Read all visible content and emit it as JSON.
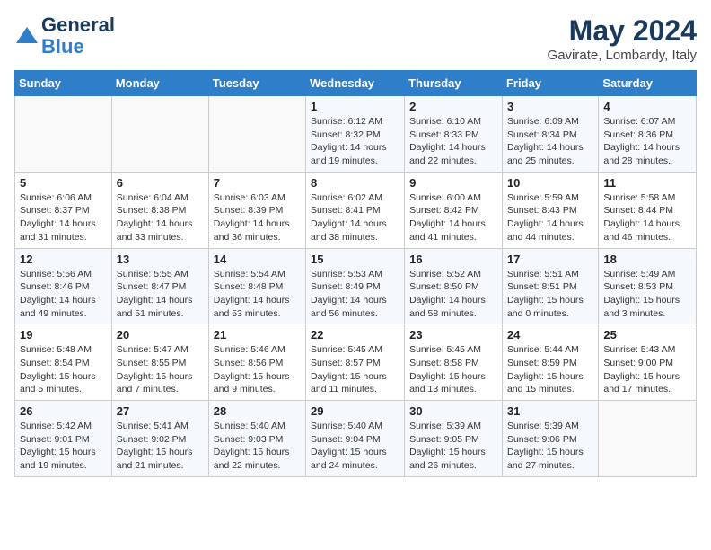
{
  "logo": {
    "line1": "General",
    "line2": "Blue"
  },
  "title": "May 2024",
  "location": "Gavirate, Lombardy, Italy",
  "weekdays": [
    "Sunday",
    "Monday",
    "Tuesday",
    "Wednesday",
    "Thursday",
    "Friday",
    "Saturday"
  ],
  "weeks": [
    [
      {
        "day": "",
        "info": ""
      },
      {
        "day": "",
        "info": ""
      },
      {
        "day": "",
        "info": ""
      },
      {
        "day": "1",
        "info": "Sunrise: 6:12 AM\nSunset: 8:32 PM\nDaylight: 14 hours\nand 19 minutes."
      },
      {
        "day": "2",
        "info": "Sunrise: 6:10 AM\nSunset: 8:33 PM\nDaylight: 14 hours\nand 22 minutes."
      },
      {
        "day": "3",
        "info": "Sunrise: 6:09 AM\nSunset: 8:34 PM\nDaylight: 14 hours\nand 25 minutes."
      },
      {
        "day": "4",
        "info": "Sunrise: 6:07 AM\nSunset: 8:36 PM\nDaylight: 14 hours\nand 28 minutes."
      }
    ],
    [
      {
        "day": "5",
        "info": "Sunrise: 6:06 AM\nSunset: 8:37 PM\nDaylight: 14 hours\nand 31 minutes."
      },
      {
        "day": "6",
        "info": "Sunrise: 6:04 AM\nSunset: 8:38 PM\nDaylight: 14 hours\nand 33 minutes."
      },
      {
        "day": "7",
        "info": "Sunrise: 6:03 AM\nSunset: 8:39 PM\nDaylight: 14 hours\nand 36 minutes."
      },
      {
        "day": "8",
        "info": "Sunrise: 6:02 AM\nSunset: 8:41 PM\nDaylight: 14 hours\nand 38 minutes."
      },
      {
        "day": "9",
        "info": "Sunrise: 6:00 AM\nSunset: 8:42 PM\nDaylight: 14 hours\nand 41 minutes."
      },
      {
        "day": "10",
        "info": "Sunrise: 5:59 AM\nSunset: 8:43 PM\nDaylight: 14 hours\nand 44 minutes."
      },
      {
        "day": "11",
        "info": "Sunrise: 5:58 AM\nSunset: 8:44 PM\nDaylight: 14 hours\nand 46 minutes."
      }
    ],
    [
      {
        "day": "12",
        "info": "Sunrise: 5:56 AM\nSunset: 8:46 PM\nDaylight: 14 hours\nand 49 minutes."
      },
      {
        "day": "13",
        "info": "Sunrise: 5:55 AM\nSunset: 8:47 PM\nDaylight: 14 hours\nand 51 minutes."
      },
      {
        "day": "14",
        "info": "Sunrise: 5:54 AM\nSunset: 8:48 PM\nDaylight: 14 hours\nand 53 minutes."
      },
      {
        "day": "15",
        "info": "Sunrise: 5:53 AM\nSunset: 8:49 PM\nDaylight: 14 hours\nand 56 minutes."
      },
      {
        "day": "16",
        "info": "Sunrise: 5:52 AM\nSunset: 8:50 PM\nDaylight: 14 hours\nand 58 minutes."
      },
      {
        "day": "17",
        "info": "Sunrise: 5:51 AM\nSunset: 8:51 PM\nDaylight: 15 hours\nand 0 minutes."
      },
      {
        "day": "18",
        "info": "Sunrise: 5:49 AM\nSunset: 8:53 PM\nDaylight: 15 hours\nand 3 minutes."
      }
    ],
    [
      {
        "day": "19",
        "info": "Sunrise: 5:48 AM\nSunset: 8:54 PM\nDaylight: 15 hours\nand 5 minutes."
      },
      {
        "day": "20",
        "info": "Sunrise: 5:47 AM\nSunset: 8:55 PM\nDaylight: 15 hours\nand 7 minutes."
      },
      {
        "day": "21",
        "info": "Sunrise: 5:46 AM\nSunset: 8:56 PM\nDaylight: 15 hours\nand 9 minutes."
      },
      {
        "day": "22",
        "info": "Sunrise: 5:45 AM\nSunset: 8:57 PM\nDaylight: 15 hours\nand 11 minutes."
      },
      {
        "day": "23",
        "info": "Sunrise: 5:45 AM\nSunset: 8:58 PM\nDaylight: 15 hours\nand 13 minutes."
      },
      {
        "day": "24",
        "info": "Sunrise: 5:44 AM\nSunset: 8:59 PM\nDaylight: 15 hours\nand 15 minutes."
      },
      {
        "day": "25",
        "info": "Sunrise: 5:43 AM\nSunset: 9:00 PM\nDaylight: 15 hours\nand 17 minutes."
      }
    ],
    [
      {
        "day": "26",
        "info": "Sunrise: 5:42 AM\nSunset: 9:01 PM\nDaylight: 15 hours\nand 19 minutes."
      },
      {
        "day": "27",
        "info": "Sunrise: 5:41 AM\nSunset: 9:02 PM\nDaylight: 15 hours\nand 21 minutes."
      },
      {
        "day": "28",
        "info": "Sunrise: 5:40 AM\nSunset: 9:03 PM\nDaylight: 15 hours\nand 22 minutes."
      },
      {
        "day": "29",
        "info": "Sunrise: 5:40 AM\nSunset: 9:04 PM\nDaylight: 15 hours\nand 24 minutes."
      },
      {
        "day": "30",
        "info": "Sunrise: 5:39 AM\nSunset: 9:05 PM\nDaylight: 15 hours\nand 26 minutes."
      },
      {
        "day": "31",
        "info": "Sunrise: 5:39 AM\nSunset: 9:06 PM\nDaylight: 15 hours\nand 27 minutes."
      },
      {
        "day": "",
        "info": ""
      }
    ]
  ]
}
